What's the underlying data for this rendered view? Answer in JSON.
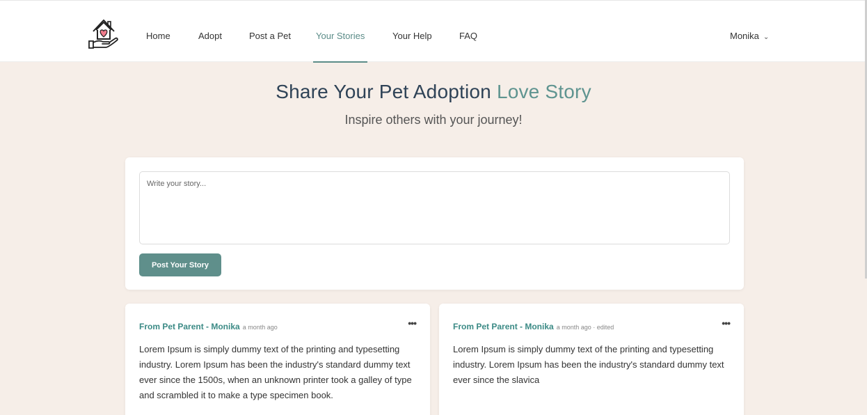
{
  "nav": {
    "links": [
      {
        "label": "Home",
        "active": false
      },
      {
        "label": "Adopt",
        "active": false
      },
      {
        "label": "Post a Pet",
        "active": false
      },
      {
        "label": "Your Stories",
        "active": true
      },
      {
        "label": "Your Help",
        "active": false
      },
      {
        "label": "FAQ",
        "active": false
      }
    ],
    "user": "Monika",
    "logo_icon": "house-heart-hand-icon"
  },
  "hero": {
    "title_main": "Share Your Pet Adoption",
    "title_accent": "Love Story",
    "subtitle": "Inspire others with your journey!"
  },
  "composer": {
    "placeholder": "Write your story...",
    "value": "",
    "button_label": "Post Your Story"
  },
  "stories": [
    {
      "author": "From Pet Parent - Monika",
      "meta": "a month ago",
      "menu_icon": "more-horizontal-icon",
      "body": "Lorem Ipsum is simply dummy text of the printing and typesetting industry. Lorem Ipsum has been the industry's standard dummy text ever since the 1500s, when an unknown printer took a galley of type and scrambled it to make a type specimen book."
    },
    {
      "author": "From Pet Parent - Monika",
      "meta": "a month ago · edited",
      "menu_icon": "more-horizontal-icon",
      "body": "Lorem Ipsum is simply dummy text of the printing and typesetting industry. Lorem Ipsum has been the industry's standard dummy text ever since the slavica"
    }
  ],
  "colors": {
    "accent": "#5f8f8b",
    "background": "#f6eee8",
    "heading": "#2f4357"
  }
}
